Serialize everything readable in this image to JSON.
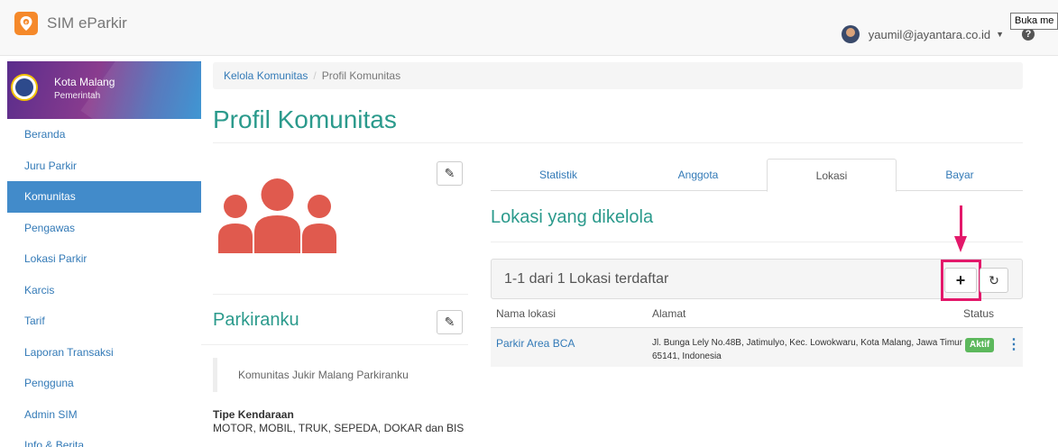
{
  "navbar": {
    "brand": "SIM eParkir",
    "user_email": "yaumil@jayantara.co.id",
    "tooltip": "Buka me"
  },
  "sidebar": {
    "header_title": "Kota Malang",
    "header_subtitle": "Pemerintah",
    "items": [
      {
        "label": "Beranda"
      },
      {
        "label": "Juru Parkir"
      },
      {
        "label": "Komunitas"
      },
      {
        "label": "Pengawas"
      },
      {
        "label": "Lokasi Parkir"
      },
      {
        "label": "Karcis"
      },
      {
        "label": "Tarif"
      },
      {
        "label": "Laporan Transaksi"
      },
      {
        "label": "Pengguna"
      },
      {
        "label": "Admin SIM"
      },
      {
        "label": "Info & Berita"
      }
    ],
    "active_item": "Komunitas"
  },
  "breadcrumb": {
    "parent": "Kelola Komunitas",
    "current": "Profil Komunitas"
  },
  "page_title": "Profil Komunitas",
  "profile": {
    "name": "Parkiranku",
    "description": "Komunitas Jukir Malang Parkiranku",
    "vehicle_label": "Tipe Kendaraan",
    "vehicle_value": "MOTOR, MOBIL, TRUK, SEPEDA, DOKAR dan BIS"
  },
  "tabs": [
    {
      "label": "Statistik"
    },
    {
      "label": "Anggota"
    },
    {
      "label": "Lokasi"
    },
    {
      "label": "Bayar"
    }
  ],
  "active_tab": "Lokasi",
  "locations": {
    "title": "Lokasi yang dikelola",
    "count_text": "1-1 dari 1 Lokasi terdaftar",
    "columns": [
      "Nama lokasi",
      "Alamat",
      "Status"
    ],
    "rows": [
      {
        "name": "Parkir Area BCA",
        "address": "Jl. Bunga Lely No.48B, Jatimulyo, Kec. Lowokwaru, Kota Malang, Jawa Timur 65141, Indonesia",
        "status": "Aktif"
      }
    ]
  },
  "colors": {
    "accent": "#2b9a8c",
    "link": "#337ab7",
    "sidebar_active": "#428bca",
    "highlight": "#e3186a",
    "status_active": "#5cb85c",
    "people_icon": "#e05a4e"
  },
  "icons": {
    "brand": "location-pin-icon",
    "help": "question-circle-icon",
    "edit": "edit-square-icon",
    "add": "plus-icon",
    "refresh": "refresh-icon",
    "row_menu": "kebab-menu-icon",
    "profile_image": "people-group-icon"
  }
}
